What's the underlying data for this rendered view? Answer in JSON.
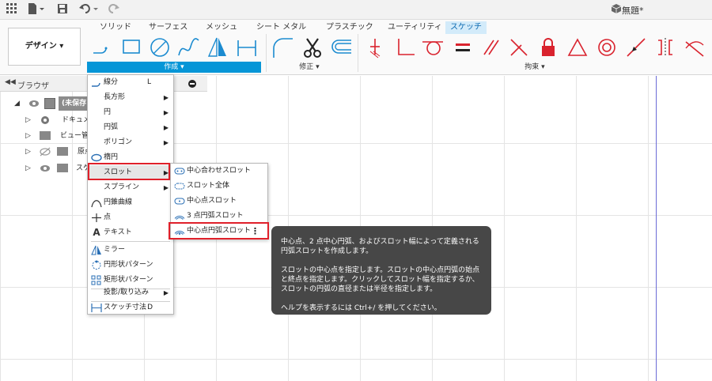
{
  "topbar": {
    "doc_title": "無題*"
  },
  "ribbon": {
    "tabs": [
      "ソリッド",
      "サーフェス",
      "メッシュ",
      "シート メタル",
      "プラスチック",
      "ユーティリティ",
      "スケッチ"
    ],
    "active_tab": "スケッチ",
    "workspace_label": "デザイン ▾",
    "groups": {
      "create": "作成 ▾",
      "modify": "修正 ▾",
      "constraints": "拘束 ▾"
    }
  },
  "browser": {
    "title": "ブラウザ",
    "items": [
      {
        "label": "(未保存)"
      },
      {
        "label": "ドキュメント"
      },
      {
        "label": "ビュー管理"
      },
      {
        "label": "原点"
      },
      {
        "label": "スケッチ"
      }
    ]
  },
  "create_menu": {
    "items": [
      {
        "label": "線分",
        "shortcut": "L",
        "icon": "line-icon"
      },
      {
        "label": "長方形",
        "submenu": true
      },
      {
        "label": "円",
        "submenu": true
      },
      {
        "label": "円弧",
        "submenu": true
      },
      {
        "label": "ポリゴン",
        "submenu": true
      },
      {
        "label": "楕円",
        "icon": "ellipse-icon"
      },
      {
        "label": "スロット",
        "submenu": true
      },
      {
        "label": "スプライン",
        "submenu": true
      },
      {
        "label": "円錐曲線",
        "icon": "conic-icon"
      },
      {
        "label": "点",
        "icon": "point-icon"
      },
      {
        "label": "テキスト",
        "icon": "text-icon"
      },
      {
        "label": "ミラー",
        "icon": "mirror-icon"
      },
      {
        "label": "円形状パターン",
        "icon": "circular-pattern-icon"
      },
      {
        "label": "矩形状パターン",
        "icon": "rect-pattern-icon"
      },
      {
        "label": "投影/取り込み",
        "submenu": true
      },
      {
        "label": "スケッチ寸法",
        "shortcut": "D",
        "icon": "dimension-icon"
      }
    ]
  },
  "slot_menu": {
    "items": [
      {
        "label": "中心合わせスロット"
      },
      {
        "label": "スロット全体"
      },
      {
        "label": "中心点スロット"
      },
      {
        "label": "3 点円弧スロット"
      },
      {
        "label": "中心点円弧スロット"
      }
    ],
    "more_icon": "⋮"
  },
  "tooltip": {
    "para1": "中心点、2 点中心円弧、およびスロット幅によって定義される円弧スロットを作成します。",
    "para2": "スロットの中心点を指定します。スロットの中心点円弧の始点と終点を指定します。クリックしてスロット幅を指定するか、スロットの円弧の直径または半径を指定します。",
    "para3": "ヘルプを表示するには Ctrl+/ を押してください。"
  },
  "colors": {
    "accent": "#0696d7",
    "highlight_border": "#e0202a",
    "tooltip_bg": "#474747",
    "constraint_red": "#d9232e"
  }
}
